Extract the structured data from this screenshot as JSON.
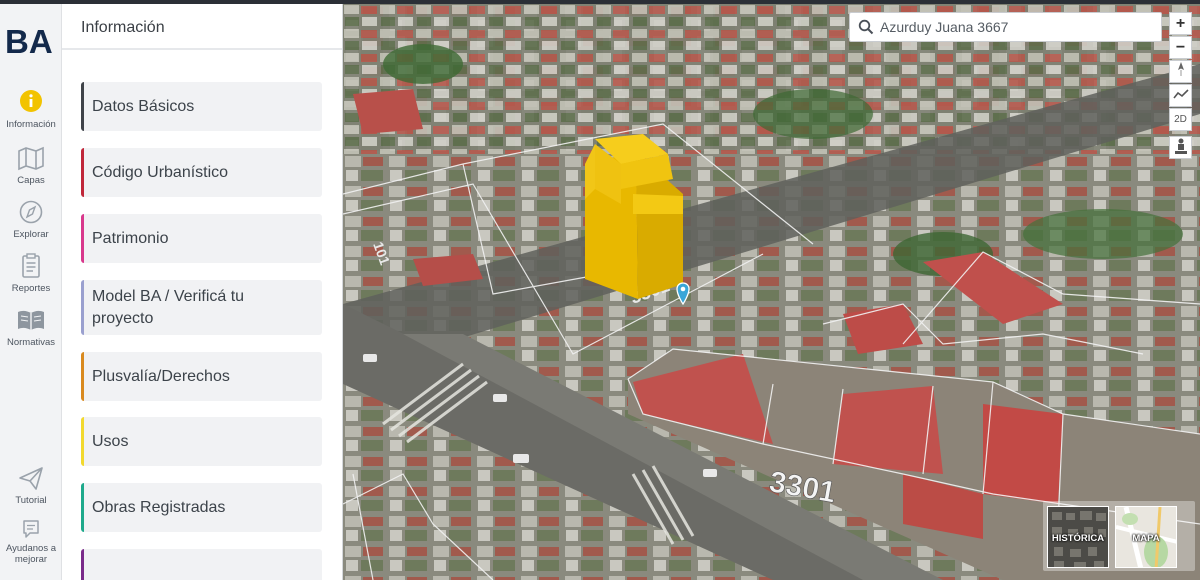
{
  "rail": {
    "logo_text": "BA",
    "items": [
      {
        "label": "Información",
        "icon": "info-icon"
      },
      {
        "label": "Capas",
        "icon": "map-layers-icon"
      },
      {
        "label": "Explorar",
        "icon": "compass-icon"
      },
      {
        "label": "Reportes",
        "icon": "clipboard-icon"
      },
      {
        "label": "Normativas",
        "icon": "book-icon"
      },
      {
        "label": "Tutorial",
        "icon": "paper-plane-icon"
      },
      {
        "label": "Ayudanos a mejorar",
        "icon": "feedback-icon"
      }
    ]
  },
  "panel": {
    "title": "Información",
    "cards": [
      {
        "label": "Datos Básicos",
        "color": "#3f4349"
      },
      {
        "label": "Código Urbanístico",
        "color": "#c0273a"
      },
      {
        "label": "Patrimonio",
        "color": "#d8388c"
      },
      {
        "label": "Model BA / Verificá tu proyecto",
        "color": "#9aa0cf"
      },
      {
        "label": "Plusvalía/Derechos",
        "color": "#d98a1f"
      },
      {
        "label": "Usos",
        "color": "#f2d92e"
      },
      {
        "label": "Obras Registradas",
        "color": "#1ea98b"
      }
    ]
  },
  "map": {
    "search_value": "Azurduy Juana 3667",
    "controls": {
      "zoom_in": "+",
      "zoom_out": "−",
      "view_2d": "2D"
    },
    "street_numbers": [
      "3301",
      "3301",
      "101"
    ],
    "basemaps": [
      {
        "label": "HISTÓRICA"
      },
      {
        "label": "MAPA"
      }
    ]
  },
  "colors": {
    "accent": "#f2c300",
    "building": "#f2c414",
    "rail_bg": "#f2f3f5"
  }
}
